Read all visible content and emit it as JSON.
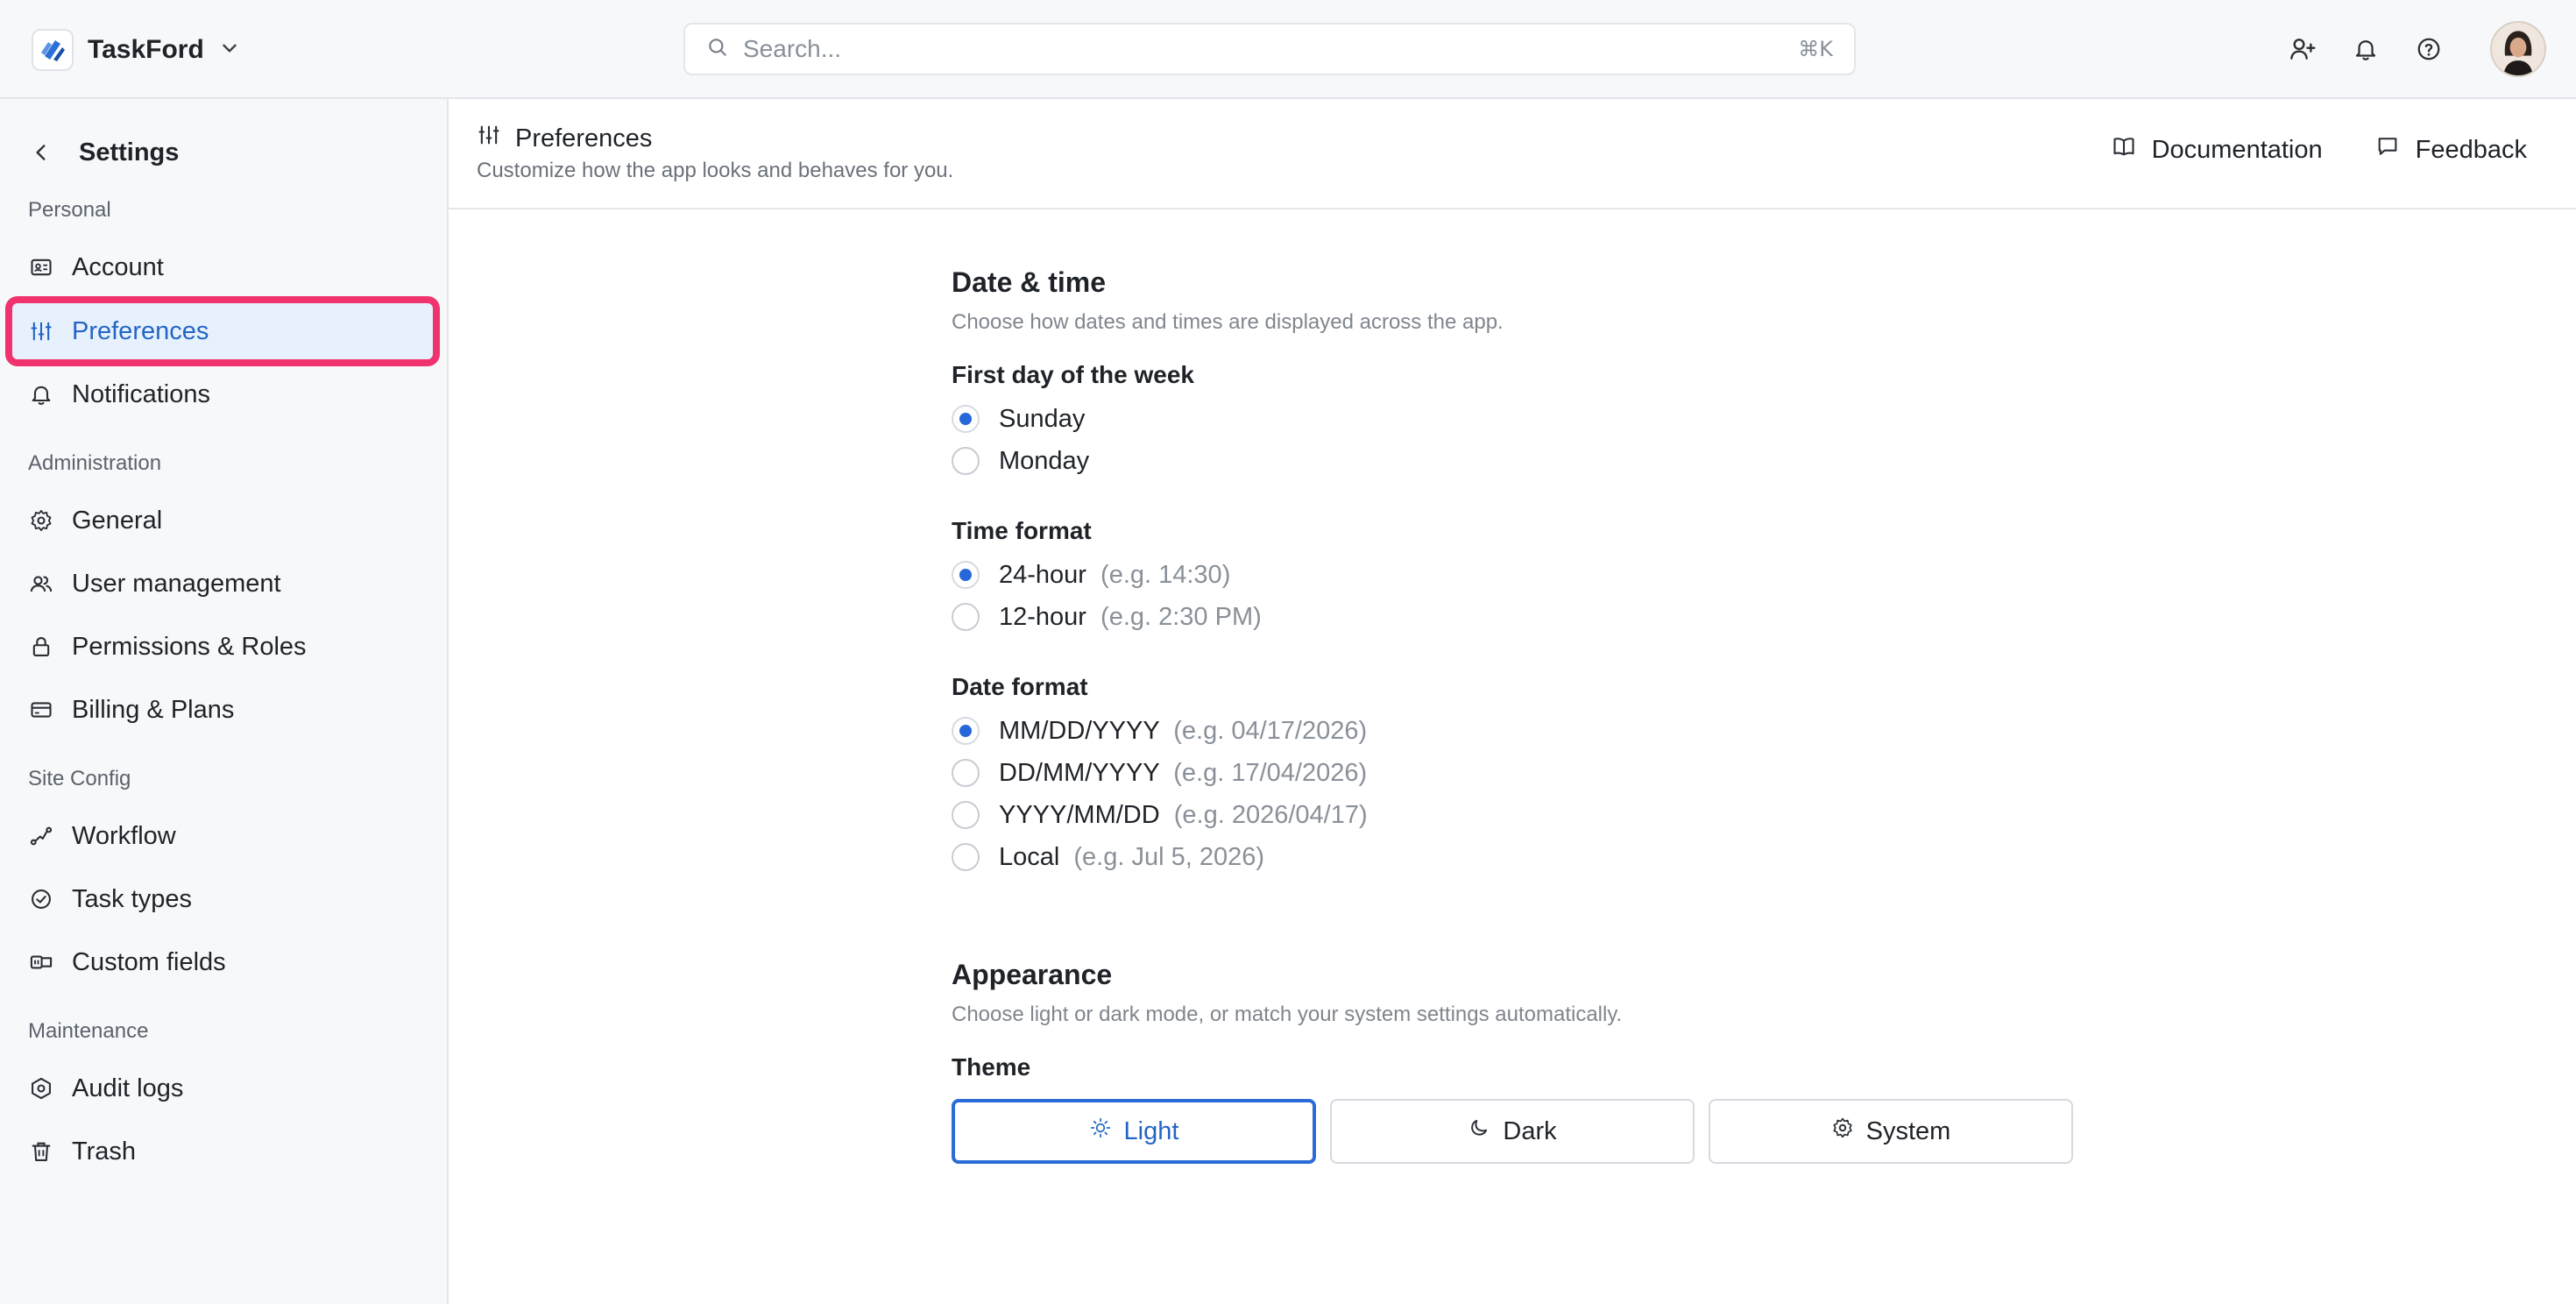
{
  "brand": {
    "name": "TaskFord"
  },
  "search": {
    "placeholder": "Search...",
    "shortcut": "⌘K"
  },
  "sidebar": {
    "title": "Settings",
    "groups": [
      {
        "label": "Personal"
      },
      {
        "label": "Administration"
      },
      {
        "label": "Site Config"
      },
      {
        "label": "Maintenance"
      }
    ],
    "items": [
      {
        "label": "Account",
        "icon": "id-card-icon"
      },
      {
        "label": "Preferences",
        "icon": "sliders-icon",
        "active": true
      },
      {
        "label": "Notifications",
        "icon": "bell-icon"
      },
      {
        "label": "General",
        "icon": "gear-icon"
      },
      {
        "label": "User management",
        "icon": "users-icon"
      },
      {
        "label": "Permissions & Roles",
        "icon": "lock-icon"
      },
      {
        "label": "Billing & Plans",
        "icon": "credit-card-icon"
      },
      {
        "label": "Workflow",
        "icon": "workflow-icon"
      },
      {
        "label": "Task types",
        "icon": "check-circle-icon"
      },
      {
        "label": "Custom fields",
        "icon": "tag-field-icon"
      },
      {
        "label": "Audit logs",
        "icon": "hexagon-icon"
      },
      {
        "label": "Trash",
        "icon": "trash-icon"
      }
    ]
  },
  "header": {
    "title": "Preferences",
    "subtitle": "Customize how the app looks and behaves for you.",
    "documentation": "Documentation",
    "feedback": "Feedback"
  },
  "datetime": {
    "title": "Date & time",
    "desc": "Choose how dates and times are displayed across the app.",
    "first_day": {
      "label": "First day of the week",
      "options": [
        {
          "label": "Sunday",
          "selected": true
        },
        {
          "label": "Monday",
          "selected": false
        }
      ]
    },
    "time_format": {
      "label": "Time format",
      "options": [
        {
          "label": "24-hour",
          "hint": "(e.g. 14:30)",
          "selected": true
        },
        {
          "label": "12-hour",
          "hint": "(e.g. 2:30 PM)",
          "selected": false
        }
      ]
    },
    "date_format": {
      "label": "Date format",
      "options": [
        {
          "label": "MM/DD/YYYY",
          "hint": "(e.g. 04/17/2026)",
          "selected": true
        },
        {
          "label": "DD/MM/YYYY",
          "hint": "(e.g. 17/04/2026)",
          "selected": false
        },
        {
          "label": "YYYY/MM/DD",
          "hint": "(e.g. 2026/04/17)",
          "selected": false
        },
        {
          "label": "Local",
          "hint": "(e.g. Jul 5, 2026)",
          "selected": false
        }
      ]
    }
  },
  "appearance": {
    "title": "Appearance",
    "desc": "Choose light or dark mode, or match your system settings automatically.",
    "theme_label": "Theme",
    "themes": [
      {
        "label": "Light",
        "icon": "sun-icon",
        "selected": true
      },
      {
        "label": "Dark",
        "icon": "moon-icon",
        "selected": false
      },
      {
        "label": "System",
        "icon": "gear-icon",
        "selected": false
      }
    ]
  },
  "colors": {
    "accent": "#2667d9",
    "highlight": "#f0336e",
    "active_bg": "#e6f1fd"
  }
}
